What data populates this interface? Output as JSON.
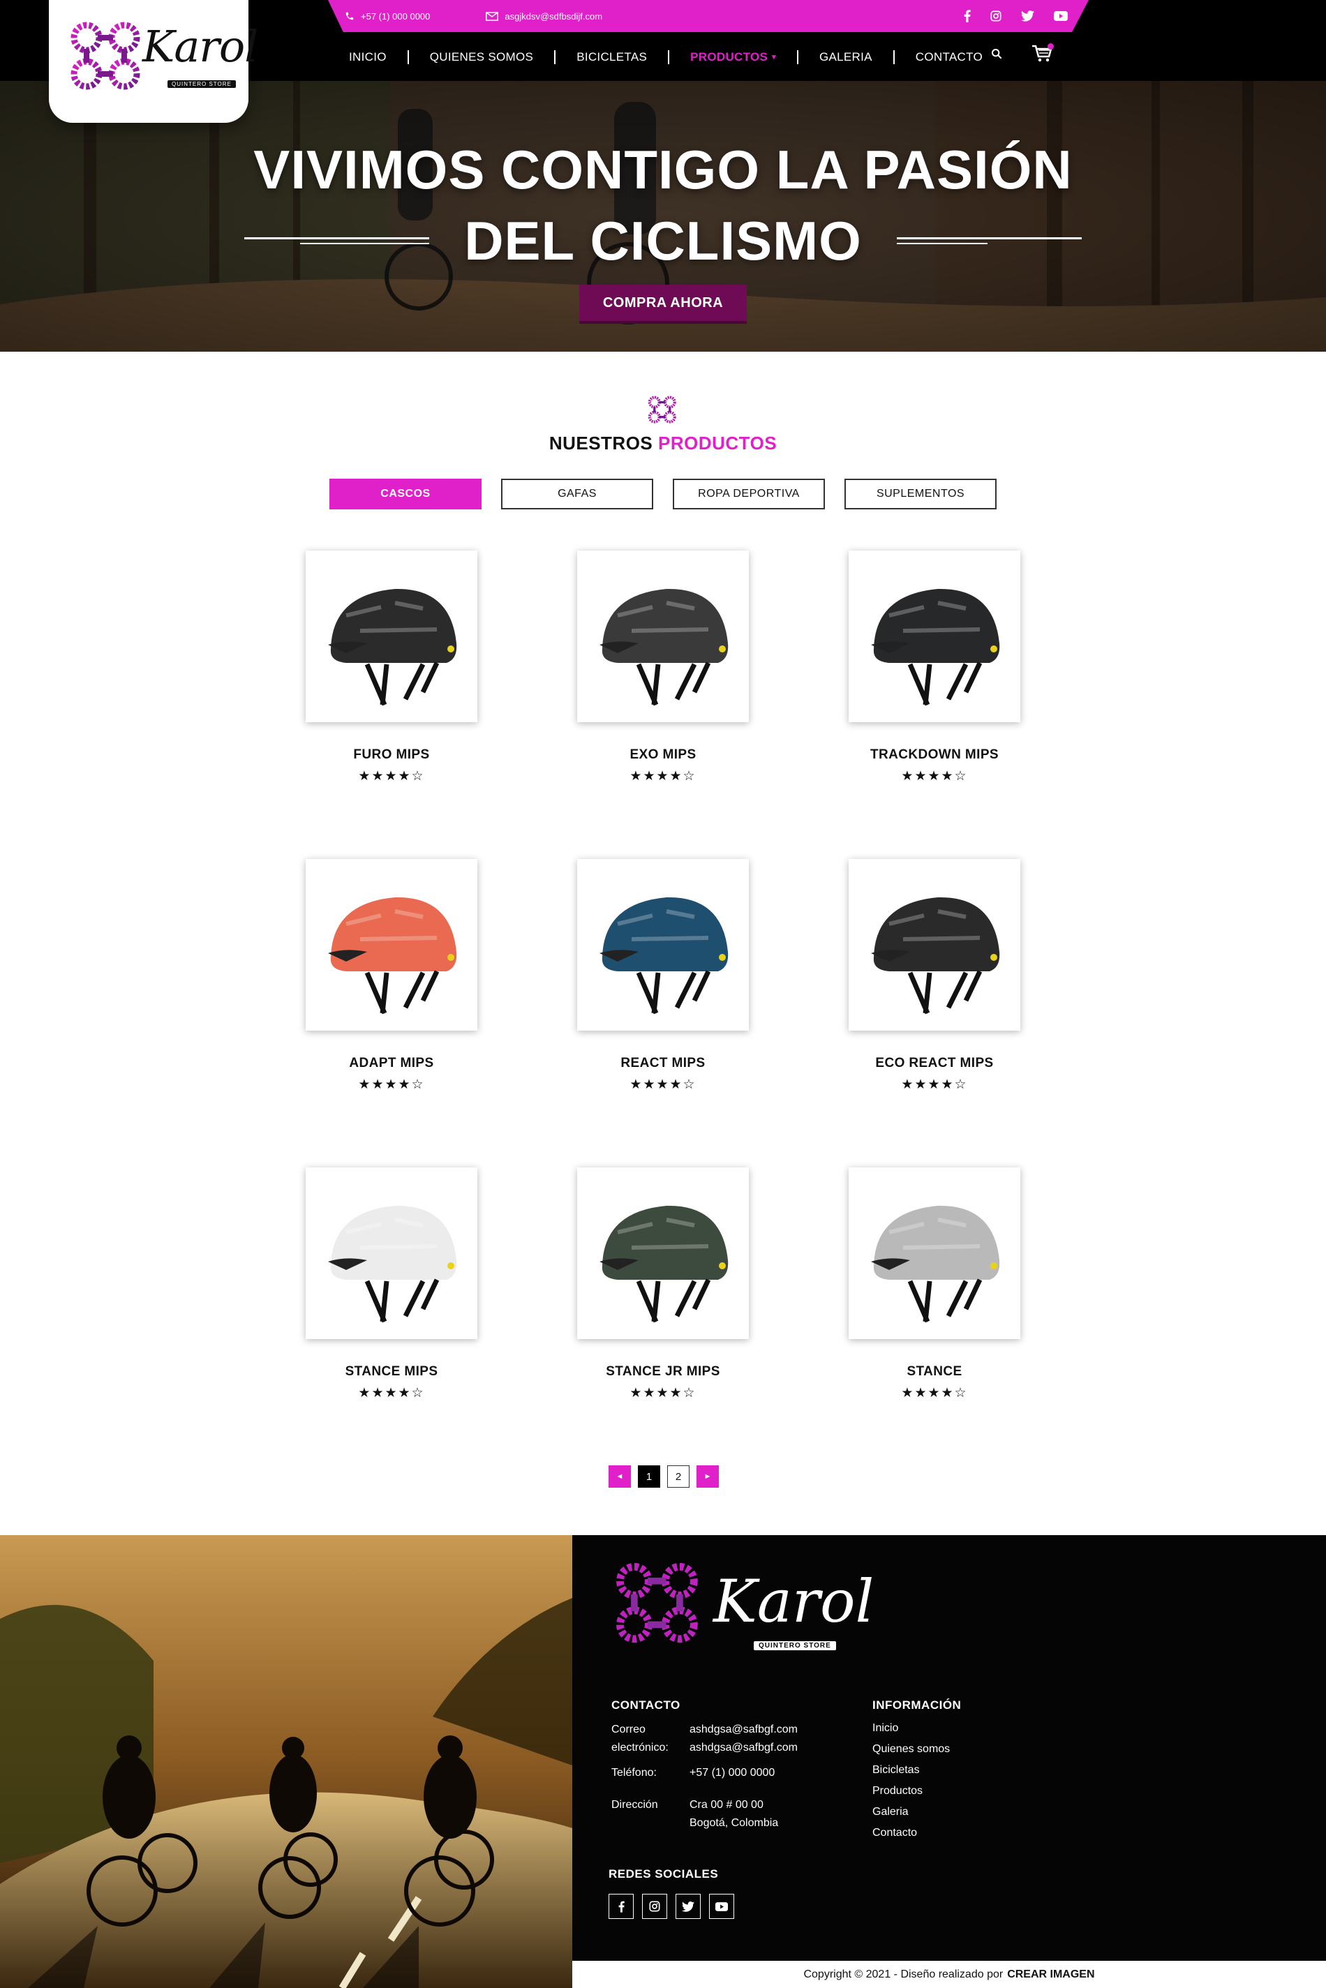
{
  "header": {
    "phone": "+57 (1) 000 0000",
    "email": "asgjkdsv@sdfbsdijf.com",
    "social_icons": [
      "facebook-icon",
      "instagram-icon",
      "twitter-icon",
      "youtube-icon"
    ],
    "menu": [
      "INICIO",
      "QUIENES SOMOS",
      "BICICLETAS",
      "PRODUCTOS",
      "GALERIA",
      "CONTACTO"
    ],
    "active_menu": "PRODUCTOS",
    "logo_text": "Karol",
    "logo_tag": "QUINTERO STORE"
  },
  "hero": {
    "title_line1": "VIVIMOS CONTIGO LA PASIÓN",
    "title_line2": "DEL CICLISMO",
    "cta": "COMPRA AHORA"
  },
  "products_section": {
    "title_plain": "NUESTROS",
    "title_accent": "PRODUCTOS",
    "tabs": [
      "CASCOS",
      "GAFAS",
      "ROPA DEPORTIVA",
      "SUPLEMENTOS"
    ],
    "active_tab": "CASCOS",
    "items": [
      {
        "name": "FURO MIPS",
        "rating": 4,
        "stars": "★★★★☆",
        "color": "#2b2b2b"
      },
      {
        "name": "EXO MIPS",
        "rating": 4,
        "stars": "★★★★☆",
        "color": "#3a3a3a"
      },
      {
        "name": "TRACKDOWN MIPS",
        "rating": 4,
        "stars": "★★★★☆",
        "color": "#26282a"
      },
      {
        "name": "ADAPT MIPS",
        "rating": 4,
        "stars": "★★★★☆",
        "color": "#e96a50"
      },
      {
        "name": "REACT MIPS",
        "rating": 4,
        "stars": "★★★★☆",
        "color": "#1f4f6e"
      },
      {
        "name": "ECO REACT MIPS",
        "rating": 4,
        "stars": "★★★★☆",
        "color": "#2a2a2a"
      },
      {
        "name": "STANCE MIPS",
        "rating": 4,
        "stars": "★★★★☆",
        "color": "#ececec"
      },
      {
        "name": "STANCE JR MIPS",
        "rating": 4,
        "stars": "★★★★☆",
        "color": "#3d4a3e"
      },
      {
        "name": "STANCE",
        "rating": 4,
        "stars": "★★★★☆",
        "color": "#b9b9b9"
      }
    ],
    "pagination": {
      "prev": "◄",
      "pages": [
        "1",
        "2"
      ],
      "current": "1",
      "next": "►"
    }
  },
  "footer": {
    "logo_text": "Karol",
    "logo_tag": "QUINTERO STORE",
    "contact_heading": "CONTACTO",
    "email_label_1": "Correo",
    "email_label_2": "electrónico:",
    "email_1": "ashdgsa@safbgf.com",
    "email_2": "ashdgsa@safbgf.com",
    "phone_label": "Teléfono:",
    "phone": "+57 (1) 000 0000",
    "address_label": "Dirección",
    "address_1": "Cra 00 # 00 00",
    "address_2": "Bogotá, Colombia",
    "info_heading": "INFORMACIÓN",
    "info_links": [
      "Inicio",
      "Quienes somos",
      "Bicicletas",
      "Productos",
      "Galeria",
      "Contacto"
    ],
    "social_heading": "REDES SOCIALES",
    "social_icons": [
      "facebook-icon",
      "instagram-icon",
      "twitter-icon",
      "youtube-icon"
    ],
    "copyright_text": "Copyright © 2021 - Diseño realizado por",
    "copyright_brand": "CREAR IMAGEN"
  },
  "colors": {
    "accent": "#e020c8",
    "dark": "#000000",
    "hero_button": "#6f0a55"
  }
}
